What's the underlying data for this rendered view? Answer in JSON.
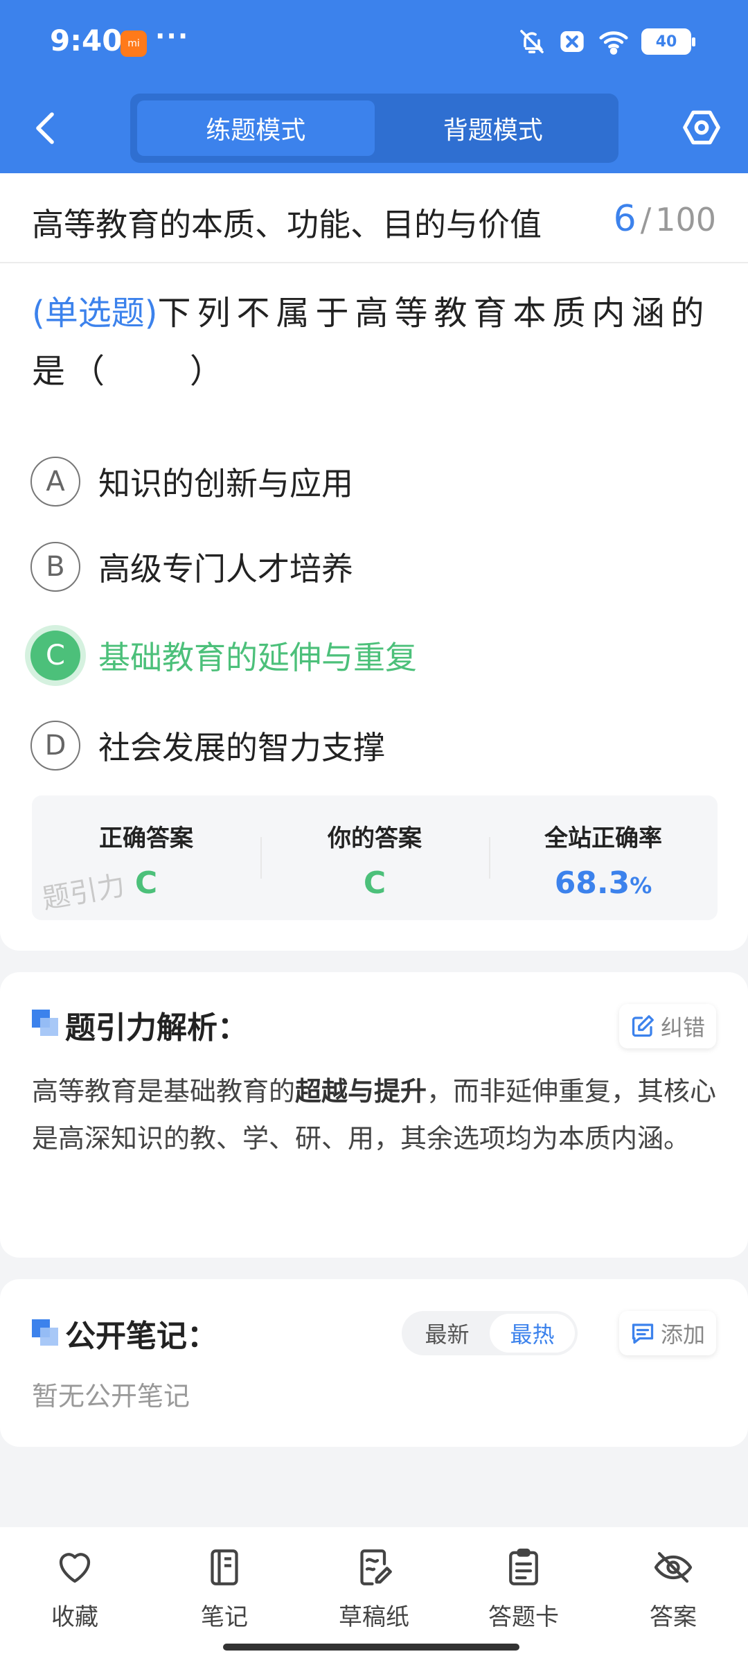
{
  "status_bar": {
    "time": "9:40",
    "app_badge": "mi",
    "dots": "···",
    "battery": "40"
  },
  "header": {
    "tabs": [
      {
        "label": "练题模式",
        "active": true
      },
      {
        "label": "背题模式",
        "active": false
      }
    ]
  },
  "question": {
    "section_title": "高等教育的本质、功能、目的与价值",
    "current": "6",
    "separator": "/",
    "total": "100",
    "type_label": "(单选题)",
    "text": "下列不属于高等教育本质内涵的是（　　）",
    "options": [
      {
        "letter": "A",
        "text": "知识的创新与应用",
        "state": "normal"
      },
      {
        "letter": "B",
        "text": "高级专门人才培养",
        "state": "normal"
      },
      {
        "letter": "C",
        "text": "基础教育的延伸与重复",
        "state": "correct"
      },
      {
        "letter": "D",
        "text": "社会发展的智力支撑",
        "state": "normal"
      }
    ]
  },
  "stats": {
    "correct_label": "正确答案",
    "correct_value": "C",
    "yours_label": "你的答案",
    "yours_value": "C",
    "rate_label": "全站正确率",
    "rate_value": "68.3",
    "rate_unit": "%",
    "watermark": "题引力"
  },
  "analysis": {
    "title": "题引力解析：",
    "report_label": "纠错",
    "text_part1": "高等教育是基础教育的",
    "text_bold": "超越与提升",
    "text_part2": "，而非延伸重复，其核心是高深知识的教、学、研、用，其余选项均为本质内涵。"
  },
  "notes": {
    "title": "公开笔记：",
    "sort_options": [
      "最新",
      "最热"
    ],
    "sort_active": "最热",
    "add_label": "添加",
    "empty_text": "暂无公开笔记"
  },
  "bottom_bar": {
    "items": [
      {
        "label": "收藏",
        "icon": "heart-icon"
      },
      {
        "label": "笔记",
        "icon": "notebook-icon"
      },
      {
        "label": "草稿纸",
        "icon": "draft-icon"
      },
      {
        "label": "答题卡",
        "icon": "answer-card-icon"
      },
      {
        "label": "答案",
        "icon": "eye-off-icon"
      }
    ]
  },
  "colors": {
    "primary": "#3c82ec",
    "correct": "#4cc07a",
    "background": "#f3f4f6"
  }
}
